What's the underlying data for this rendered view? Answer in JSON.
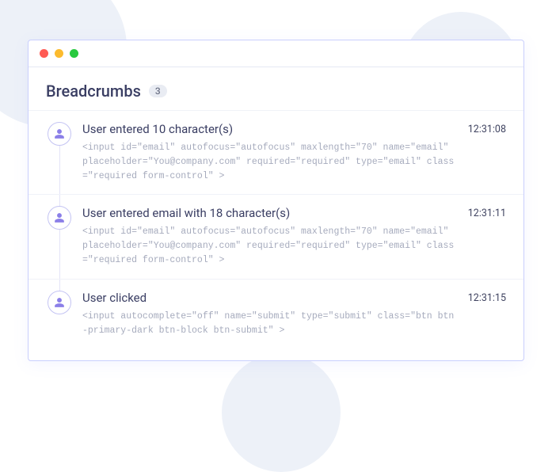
{
  "header": {
    "title": "Breadcrumbs",
    "count": "3"
  },
  "events": [
    {
      "action": "User entered 10 character(s)",
      "detail": "<input id=\"email\" autofocus=\"autofocus\" maxlength=\"70\" name=\"email\" placeholder=\"You@company.com\" required=\"required\" type=\"email\" class=\"required form-control\" >",
      "time": "12:31:08"
    },
    {
      "action": "User entered email with 18 character(s)",
      "detail": "<input id=\"email\" autofocus=\"autofocus\" maxlength=\"70\" name=\"email\" placeholder=\"You@company.com\" required=\"required\" type=\"email\" class=\"required form-control\" >",
      "time": "12:31:11"
    },
    {
      "action": "User clicked",
      "detail": "<input autocomplete=\"off\" name=\"submit\" type=\"submit\" class=\"btn btn-primary-dark btn-block btn-submit\" >",
      "time": "12:31:15"
    }
  ]
}
